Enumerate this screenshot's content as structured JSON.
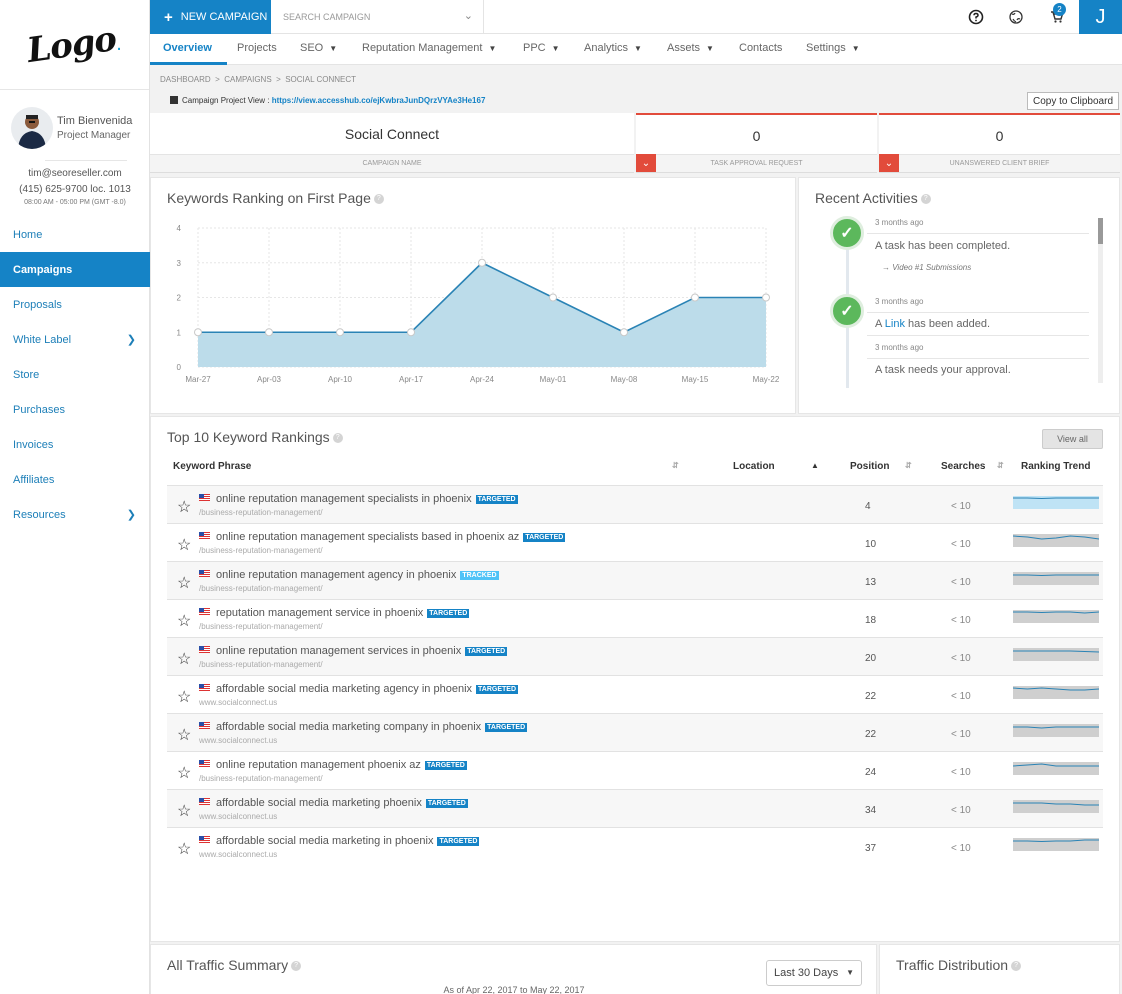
{
  "sidebar": {
    "logo": "Logo",
    "profile": {
      "name": "Tim Bienvenida",
      "role": "Project Manager",
      "email": "tim@seoreseller.com",
      "phone": "(415) 625-9700 loc. 1013",
      "hours": "08:00 AM - 05:00 PM (GMT -8.0)"
    },
    "items": [
      {
        "label": "Home"
      },
      {
        "label": "Campaigns"
      },
      {
        "label": "Proposals"
      },
      {
        "label": "White Label"
      },
      {
        "label": "Store"
      },
      {
        "label": "Purchases"
      },
      {
        "label": "Invoices"
      },
      {
        "label": "Affiliates"
      },
      {
        "label": "Resources"
      }
    ]
  },
  "topbar": {
    "new_campaign": "NEW CAMPAIGN",
    "search_placeholder": "SEARCH CAMPAIGN",
    "cart_count": "2",
    "user_initial": "J"
  },
  "tabs": [
    {
      "label": "Overview"
    },
    {
      "label": "Projects"
    },
    {
      "label": "SEO"
    },
    {
      "label": "Reputation Management"
    },
    {
      "label": "PPC"
    },
    {
      "label": "Analytics"
    },
    {
      "label": "Assets"
    },
    {
      "label": "Contacts"
    },
    {
      "label": "Settings"
    }
  ],
  "breadcrumb": "DASHBOARD  >  CAMPAIGNS  >  SOCIAL CONNECT",
  "project_view": {
    "label": "Campaign Project View :",
    "url": "https://view.accesshub.co/ejKwbraJunDQrzVYAe3He167",
    "copy_button": "Copy to Clipboard"
  },
  "stats": {
    "campaign_name": "Social Connect",
    "campaign_name_label": "CAMPAIGN NAME",
    "task_approval_value": "0",
    "task_approval_label": "TASK APPROVAL REQUEST",
    "client_brief_value": "0",
    "client_brief_label": "UNANSWERED CLIENT BRIEF"
  },
  "ranking_chart": {
    "title": "Keywords Ranking on First Page"
  },
  "chart_data": {
    "type": "area",
    "title": "Keywords Ranking on First Page",
    "categories": [
      "Mar-27",
      "Apr-03",
      "Apr-10",
      "Apr-17",
      "Apr-24",
      "May-01",
      "May-08",
      "May-15",
      "May-22"
    ],
    "values": [
      1,
      1,
      1,
      1,
      3,
      2,
      1,
      2,
      2
    ],
    "yticks": [
      "0",
      "1",
      "2",
      "3",
      "4"
    ],
    "ylim": [
      0,
      4
    ],
    "grid": true,
    "colors": {
      "fill": "#bcdcea",
      "line": "#2a83b5"
    }
  },
  "activities": {
    "title": "Recent Activities",
    "items": [
      {
        "time": "3 months ago",
        "text": "A task has been completed.",
        "sub": "→ Video #1 Submissions"
      },
      {
        "time": "3 months ago",
        "text_pre": "A ",
        "link": "Link",
        "text_post": " has been added."
      },
      {
        "time": "3 months ago",
        "text": "A task needs your approval."
      }
    ]
  },
  "keywords": {
    "title": "Top 10 Keyword Rankings",
    "view_all": "View all",
    "headers": {
      "phrase": "Keyword Phrase",
      "location": "Location",
      "position": "Position",
      "searches": "Searches",
      "trend": "Ranking Trend"
    },
    "rows": [
      {
        "phrase": "online reputation management specialists in phoenix",
        "tag": "TARGETED",
        "url": "/business-reputation-management/",
        "position": "4",
        "searches": "< 10"
      },
      {
        "phrase": "online reputation management specialists based in phoenix az",
        "tag": "TARGETED",
        "url": "/business-reputation-management/",
        "position": "10",
        "searches": "< 10"
      },
      {
        "phrase": "online reputation management agency in phoenix",
        "tag": "TRACKED",
        "url": "/business-reputation-management/",
        "position": "13",
        "searches": "< 10"
      },
      {
        "phrase": "reputation management service in phoenix",
        "tag": "TARGETED",
        "url": "/business-reputation-management/",
        "position": "18",
        "searches": "< 10"
      },
      {
        "phrase": "online reputation management services in phoenix",
        "tag": "TARGETED",
        "url": "/business-reputation-management/",
        "position": "20",
        "searches": "< 10"
      },
      {
        "phrase": "affordable social media marketing agency in phoenix",
        "tag": "TARGETED",
        "url": "www.socialconnect.us",
        "position": "22",
        "searches": "< 10"
      },
      {
        "phrase": "affordable social media marketing company in phoenix",
        "tag": "TARGETED",
        "url": "www.socialconnect.us",
        "position": "22",
        "searches": "< 10"
      },
      {
        "phrase": "online reputation management phoenix az",
        "tag": "TARGETED",
        "url": "/business-reputation-management/",
        "position": "24",
        "searches": "< 10"
      },
      {
        "phrase": "affordable social media marketing phoenix",
        "tag": "TARGETED",
        "url": "www.socialconnect.us",
        "position": "34",
        "searches": "< 10"
      },
      {
        "phrase": "affordable social media marketing in phoenix",
        "tag": "TARGETED",
        "url": "www.socialconnect.us",
        "position": "37",
        "searches": "< 10"
      }
    ]
  },
  "traffic": {
    "title": "All Traffic Summary",
    "range_select": "Last 30 Days",
    "as_of": "As of Apr 22, 2017 to May 22, 2017",
    "distribution_title": "Traffic Distribution"
  }
}
